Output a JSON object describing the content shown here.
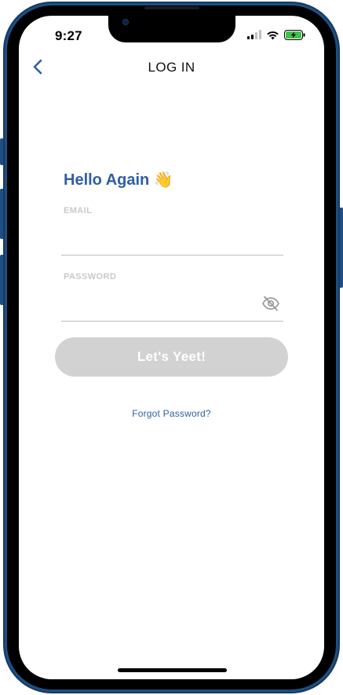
{
  "status_bar": {
    "time": "9:27",
    "signal_icon": "cellular-signal-icon",
    "signal_bars_active": 2,
    "wifi_icon": "wifi-icon",
    "battery_icon": "battery-charging-icon",
    "battery_color": "#3ec24a"
  },
  "nav": {
    "back_icon": "chevron-left-icon",
    "title": "LOG IN"
  },
  "form": {
    "greeting": "Hello Again",
    "greeting_emoji": "👋",
    "email_label": "EMAIL",
    "email_value": "",
    "password_label": "PASSWORD",
    "password_value": "",
    "password_toggle_icon": "eye-slash-icon",
    "submit_label": "Let's Yeet!",
    "forgot_password": "Forgot Password?"
  },
  "colors": {
    "accent": "#2f5ea3",
    "button_disabled": "#d2d2d2",
    "device_frame": "#1e4f82"
  }
}
